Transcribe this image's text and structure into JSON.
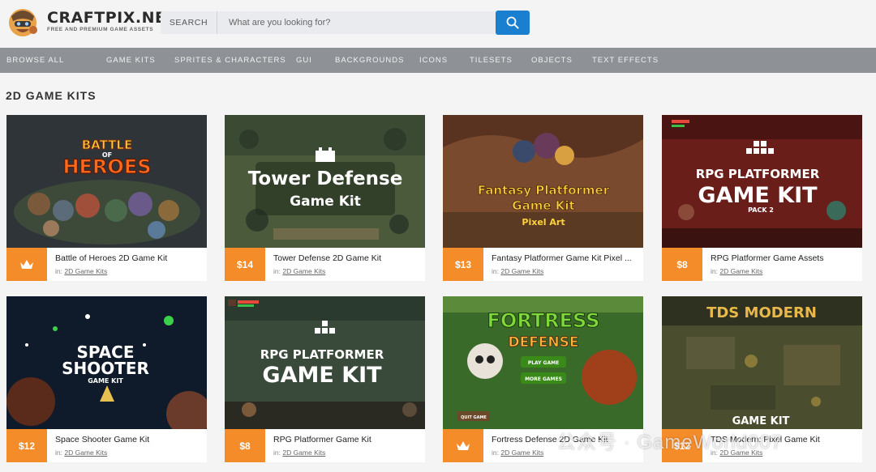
{
  "brand": {
    "name": "CRAFTPIX.NET",
    "tagline": "FREE AND PREMIUM GAME ASSETS"
  },
  "search": {
    "label": "SEARCH",
    "placeholder": "What are you looking for?",
    "icon": "search-icon"
  },
  "nav": {
    "items": [
      {
        "label": "BROWSE ALL"
      },
      {
        "label": "GAME KITS"
      },
      {
        "label": "SPRITES & CHARACTERS"
      },
      {
        "label": "GUI"
      },
      {
        "label": "BACKGROUNDS"
      },
      {
        "label": "ICONS"
      },
      {
        "label": "TILESETS"
      },
      {
        "label": "OBJECTS"
      },
      {
        "label": "TEXT EFFECTS"
      }
    ]
  },
  "section": {
    "title": "2D GAME KITS"
  },
  "products": [
    {
      "title": "Battle of Heroes 2D Game Kit",
      "price": "",
      "badge_icon": "crown-icon",
      "category_prefix": "in:",
      "category": "2D Game Kits",
      "image_text": [
        "BATTLE",
        "OF",
        "HEROES"
      ]
    },
    {
      "title": "Tower Defense 2D Game Kit",
      "price": "$14",
      "category_prefix": "in:",
      "category": "2D Game Kits",
      "image_text": [
        "Tower Defense",
        "Game Kit"
      ]
    },
    {
      "title": "Fantasy Platformer Game Kit Pixel ...",
      "price": "$13",
      "category_prefix": "in:",
      "category": "2D Game Kits",
      "image_text": [
        "Fantasy Platformer",
        "Game Kit",
        "Pixel Art"
      ]
    },
    {
      "title": "RPG Platformer Game Assets",
      "price": "$8",
      "category_prefix": "in:",
      "category": "2D Game Kits",
      "image_text": [
        "RPG PLATFORMER",
        "GAME KIT",
        "PACK 2"
      ]
    },
    {
      "title": "Space Shooter Game Kit",
      "price": "$12",
      "category_prefix": "in:",
      "category": "2D Game Kits",
      "image_text": [
        "SPACE",
        "SHOOTER",
        "GAME KIT"
      ]
    },
    {
      "title": "RPG Platformer Game Kit",
      "price": "$8",
      "category_prefix": "in:",
      "category": "2D Game Kits",
      "image_text": [
        "RPG PLATFORMER",
        "GAME KIT"
      ]
    },
    {
      "title": "Fortress Defense 2D Game Kit",
      "price": "",
      "badge_icon": "crown-icon",
      "category_prefix": "in:",
      "category": "2D Game Kits",
      "image_text": [
        "FORTRESS",
        "DEFENSE",
        "PLAY GAME",
        "MORE GAMES",
        "QUIT GAME"
      ]
    },
    {
      "title": "TDS Modern: Pixel Game Kit",
      "price": "$12",
      "category_prefix": "in:",
      "category": "2D Game Kits",
      "image_text": [
        "TDS MODERN",
        "GAME KIT"
      ]
    }
  ],
  "watermark": "公众号 · GameWorld007",
  "colors": {
    "accent": "#f58c2a",
    "nav_bg": "#8e9296",
    "search_btn": "#1a7fcf"
  }
}
